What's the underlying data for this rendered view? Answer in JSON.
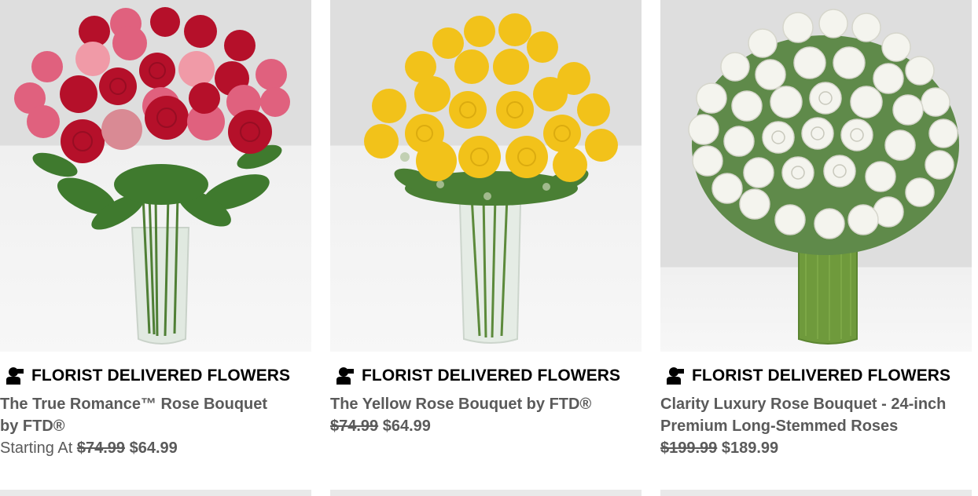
{
  "products": [
    {
      "badge": "FLORIST DELIVERED FLOWERS",
      "badge_icon": "florist-delivery-icon",
      "title_line1": "The True Romance™ Rose Bouquet",
      "title_line2": "by FTD®",
      "price_prefix": "Starting At",
      "old_price": "$74.99",
      "new_price": "$64.99",
      "image": "mixed red and pink roses in tall glass vase"
    },
    {
      "badge": "FLORIST DELIVERED FLOWERS",
      "badge_icon": "florist-delivery-icon",
      "title_line1": "The Yellow Rose Bouquet by FTD®",
      "old_price": "$74.99",
      "new_price": "$64.99",
      "image": "yellow roses in tall glass vase"
    },
    {
      "badge": "FLORIST DELIVERED FLOWERS",
      "badge_icon": "florist-delivery-icon",
      "title_line1": "Clarity Luxury Rose Bouquet - 24-inch",
      "title_line2": "Premium Long-Stemmed Roses",
      "old_price": "$199.99",
      "new_price": "$189.99",
      "image": "white roses in leaf-wrapped cylinder vase"
    }
  ],
  "colors": {
    "red_rose": "#b5102a",
    "pink_rose": "#e0617e",
    "yellow_rose": "#f2c21a",
    "white_rose": "#f4f4ee",
    "leaf": "#3f7a2e",
    "text_gray": "#5a5a5a"
  }
}
